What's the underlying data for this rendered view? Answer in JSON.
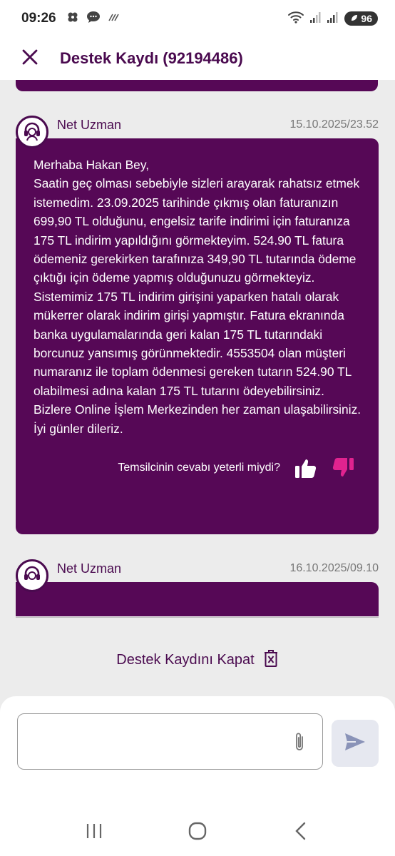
{
  "status_bar": {
    "time": "09:26",
    "battery": "96",
    "icons": [
      "pinwheel-icon",
      "chat-icon",
      "nfc-icon",
      "wifi-icon",
      "signal-icon",
      "signal-icon",
      "battery-icon"
    ]
  },
  "header": {
    "title": "Destek Kaydı (92194486)",
    "close_icon": "close-icon"
  },
  "messages": [
    {
      "sender": "Net Uzman",
      "timestamp": "15.10.2025/23.52",
      "text": "Merhaba Hakan Bey,\nSaatin geç olması sebebiyle sizleri arayarak rahatsız etmek istemedim. 23.09.2025 tarihinde çıkmış olan faturanızın 699,90 TL olduğunu, engelsiz tarife indirimi için faturanıza 175 TL indirim yapıldığını görmekteyim. 524.90 TL fatura ödemeniz gerekirken tarafınıza 349,90 TL tutarında ödeme çıktığı için ödeme yapmış olduğunuzu görmekteyiz. Sistemimiz 175 TL indirim girişini yaparken hatalı olarak mükerrer olarak indirim girişi yapmıştır. Fatura ekranında banka uygulamalarında geri kalan 175 TL tutarındaki borcunuz yansımış görünmektedir. 4553504 olan müşteri numaranız ile toplam ödenmesi gereken tutarın 524.90  TL olabilmesi adına kalan 175 TL tutarını ödeyebilirsiniz. Bizlere Online İşlem Merkezinden her zaman ulaşabilirsiniz. İyi günler dileriz.",
      "feedback_question": "Temsilcinin cevabı yeterli miydi?"
    },
    {
      "sender": "Net Uzman",
      "timestamp": "16.10.2025/09.10"
    }
  ],
  "close_ticket": {
    "label": "Destek Kaydını Kapat"
  },
  "composer": {
    "placeholder": "",
    "value": ""
  },
  "colors": {
    "brand": "#4a0a4f",
    "bubble": "#560856",
    "dislike": "#e0238f",
    "background": "#ececec"
  }
}
